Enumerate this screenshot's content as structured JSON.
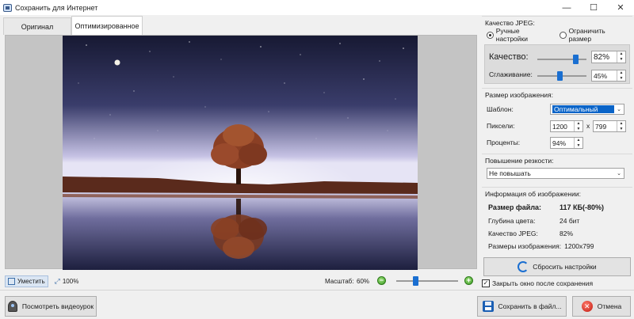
{
  "window": {
    "title": "Сохранить для Интернет",
    "minimize": "—",
    "maximize": "☐",
    "close": "✕"
  },
  "tabs": [
    {
      "label": "Оригинал",
      "active": false
    },
    {
      "label": "Оптимизированное",
      "active": true
    }
  ],
  "viewbar": {
    "fit_label": "Уместить",
    "actual_label": "100%",
    "zoom_label": "Масштаб:",
    "zoom_value": "60%",
    "zoom_level": 0.3
  },
  "jpeg": {
    "title": "Качество JPEG:",
    "mode_manual": "Ручные настройки",
    "mode_limit": "Ограничить размер",
    "quality_label": "Качество:",
    "quality_value": "82%",
    "quality_level": 0.82,
    "smoothing_label": "Сглаживание:",
    "smoothing_value": "45%",
    "smoothing_level": 0.45
  },
  "size": {
    "title": "Размер изображения:",
    "template_label": "Шаблон:",
    "template_value": "Оптимальный",
    "pixels_label": "Пиксели:",
    "width": "1200",
    "times": "x",
    "height": "799",
    "percent_label": "Проценты:",
    "percent_value": "94%"
  },
  "sharpen": {
    "title": "Повышение резкости:",
    "value": "Не повышать"
  },
  "info": {
    "title": "Информация об изображении:",
    "filesize_label": "Размер файла:",
    "filesize_value": "117 КБ(-80%)",
    "depth_label": "Глубина цвета:",
    "depth_value": "24 бит",
    "quality_label": "Качество JPEG:",
    "quality_value": "82%",
    "dims_label": "Размеры изображения:",
    "dims_value": "1200x799"
  },
  "reset_label": "Сбросить настройки",
  "close_after_save_label": "Закрыть окно после сохранения",
  "close_after_save_checked": true,
  "bottom": {
    "video_label": "Посмотреть видеоурок",
    "save_label": "Сохранить в файл...",
    "cancel_label": "Отмена"
  },
  "colors": {
    "accent": "#1a6fd1",
    "highlight": "#0a64c8",
    "sky_top": "#1a1c3a",
    "sky_horizon": "#c9c6e6",
    "tree": "#8a3f24"
  },
  "icons": {
    "app": "app-icon",
    "fit": "fit-icon",
    "actual": "actual-size-icon",
    "reset": "refresh-icon",
    "video": "webcam-icon",
    "save": "floppy-icon",
    "cancel": "cancel-icon"
  }
}
